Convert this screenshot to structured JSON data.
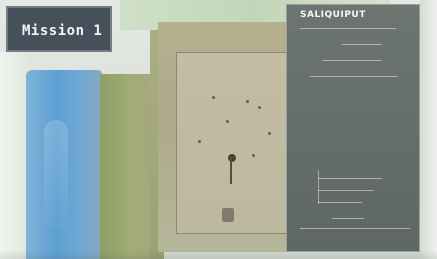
{
  "mission_banner": {
    "title": "Mission 1"
  },
  "side_panel": {
    "title": "SALIQUIPUT"
  },
  "colors": {
    "banner": "#45505b",
    "water": "#5d9fd2",
    "grass": "#8c9f66",
    "map": "#bdb8a0",
    "panel": "#6d7571"
  }
}
